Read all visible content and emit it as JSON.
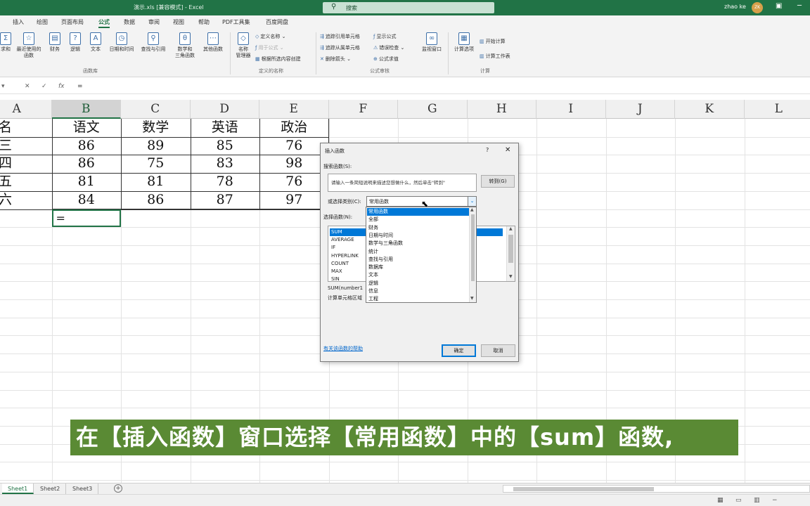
{
  "window": {
    "title": "演示.xls  [兼容模式]  -  Excel",
    "search_placeholder": "搜索",
    "user": "zhao ke",
    "avatar": "ZK"
  },
  "tabs": [
    "插入",
    "绘图",
    "页面布局",
    "公式",
    "数据",
    "审阅",
    "视图",
    "帮助",
    "PDF工具集",
    "百度网盘"
  ],
  "active_tab": "公式",
  "ribbon": {
    "function_library": {
      "buttons": [
        "求和",
        "最近使用的\n函数",
        "财务",
        "逻辑",
        "文本",
        "日期和时间",
        "查找与引用",
        "数学和\n三角函数",
        "其他函数"
      ],
      "group_label": "函数库"
    },
    "defined_names": {
      "manager": "名称\n管理器",
      "define_name": "定义名称",
      "use_in_formula": "用于公式",
      "create_from_selection": "根据所选内容创建",
      "group_label": "定义的名称"
    },
    "formula_auditing": {
      "trace_precedents": "追踪引用单元格",
      "trace_dependents": "追踪从属单元格",
      "remove_arrows": "删除箭头",
      "show_formulas": "显示公式",
      "error_checking": "错误检查",
      "evaluate_formula": "公式求值",
      "watch_window": "监视窗口",
      "group_label": "公式审核"
    },
    "calculation": {
      "options": "计算选项",
      "calculate_now": "开始计算",
      "calculate_sheet": "计算工作表",
      "group_label": "计算"
    }
  },
  "formula_bar": {
    "value": "="
  },
  "columns": [
    "A",
    "B",
    "C",
    "D",
    "E",
    "F",
    "G",
    "H",
    "I",
    "J",
    "K",
    "L"
  ],
  "table": {
    "headers": [
      "姓名",
      "语文",
      "数学",
      "英语",
      "政治"
    ],
    "rows": [
      [
        "张三",
        "86",
        "89",
        "85",
        "76"
      ],
      [
        "李四",
        "86",
        "75",
        "83",
        "98"
      ],
      [
        "王五",
        "81",
        "81",
        "78",
        "76"
      ],
      [
        "马六",
        "84",
        "86",
        "87",
        "97"
      ]
    ],
    "active_cell_value": "="
  },
  "dialog": {
    "title": "插入函数",
    "help_glyph": "?",
    "close_glyph": "✕",
    "search_label": "搜索函数(S):",
    "search_text": "请输入一条简短说明来描述您想做什么，然后单击\"转到\"",
    "goto_button": "转到(G)",
    "category_label": "或选择类别(C):",
    "category_value": "常用函数",
    "select_label": "选择函数(N):",
    "functions": [
      "SUM",
      "AVERAGE",
      "IF",
      "HYPERLINK",
      "COUNT",
      "MAX",
      "SIN"
    ],
    "selected_function": "SUM",
    "signature": "SUM(number1",
    "description": "计算单元格区域",
    "help_link": "有关该函数的帮助",
    "ok": "确定",
    "cancel": "取消"
  },
  "category_dropdown": {
    "items": [
      "常用函数",
      "全部",
      "财务",
      "日期与时间",
      "数学与三角函数",
      "统计",
      "查找与引用",
      "数据库",
      "文本",
      "逻辑",
      "信息",
      "工程"
    ],
    "selected": "常用函数"
  },
  "subtitle": "在【插入函数】窗口选择【常用函数】中的【sum】函数,",
  "sheets": [
    "Sheet1",
    "Sheet2",
    "Sheet3"
  ],
  "active_sheet": "Sheet1",
  "colors": {
    "excel_green": "#217346",
    "subtitle_bg": "#5a8a34",
    "selection_blue": "#0078d7"
  }
}
